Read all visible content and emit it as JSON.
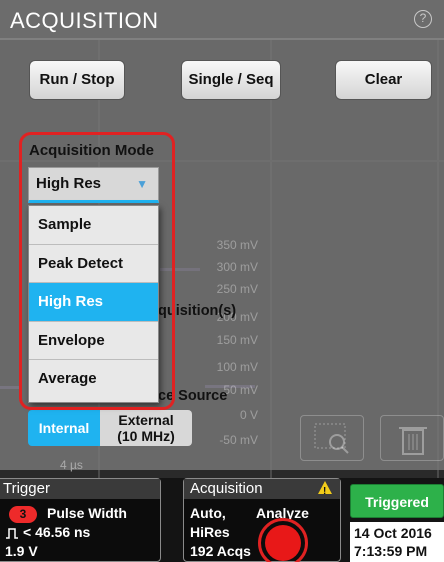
{
  "panel": {
    "title": "ACQUISITION",
    "help_icon": "?"
  },
  "buttons": {
    "run_stop": "Run / Stop",
    "single_seq": "Single / Seq",
    "clear": "Clear"
  },
  "acquisition_mode": {
    "label": "Acquisition Mode",
    "selected": "High Res",
    "options": [
      "Sample",
      "Peak Detect",
      "High Res",
      "Envelope",
      "Average"
    ]
  },
  "partial_labels": {
    "acquisitions": "quisition(s)",
    "clock_source": "ce Source"
  },
  "clock_source": {
    "internal": "Internal",
    "external_line1": "External",
    "external_line2": "(10 MHz)"
  },
  "scope": {
    "y_labels": [
      "350 mV",
      "300 mV",
      "250 mV",
      "200 mV",
      "150 mV",
      "100 mV",
      "50 mV",
      "0 V",
      "-50 mV"
    ],
    "time_label": "4 µs"
  },
  "trigger_badge": {
    "title": "Trigger",
    "channel": "3",
    "type": "Pulse Width",
    "condition": "< 46.56 ns",
    "edge_icon": "pulse-edge-icon",
    "level": "1.9 V"
  },
  "acquisition_badge": {
    "title": "Acquisition",
    "line1": "Auto,",
    "line2": "HiRes",
    "line3": "192 Acqs",
    "analyze": "Analyze"
  },
  "status": {
    "triggered": "Triggered",
    "date": "14 Oct 2016",
    "time": "7:13:59 PM"
  },
  "colors": {
    "accent_blue": "#1fb3f0",
    "triggered_green": "#2db14a",
    "highlight_red": "#e02222",
    "channel3_red": "#ee2a2a"
  }
}
